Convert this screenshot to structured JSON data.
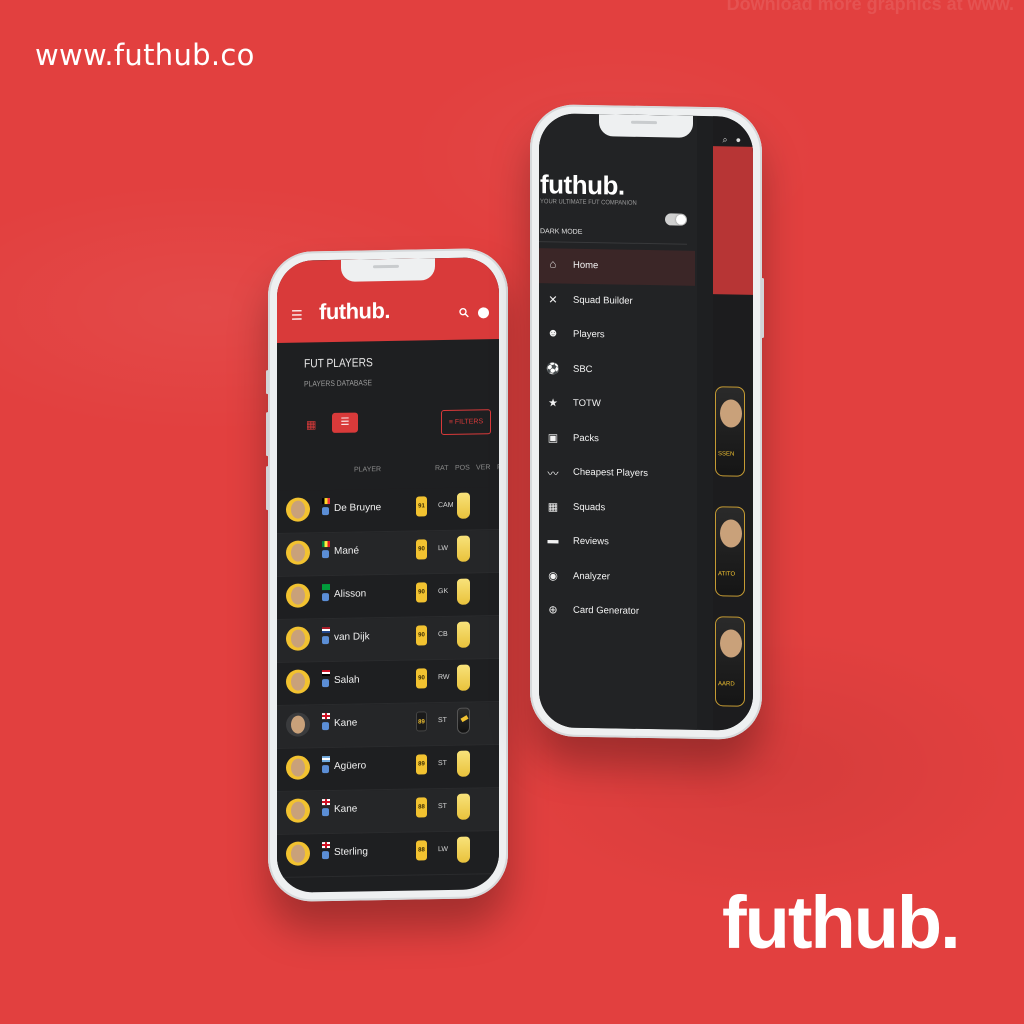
{
  "site_url": "www.futhub.co",
  "watermark": "Download more graphics at www.",
  "brand_logo": "futhub.",
  "colors": {
    "accent": "#d93a3a",
    "background": "#e2403f",
    "dark": "#1e1f21",
    "gold": "#f2c230"
  },
  "left_phone": {
    "header": {
      "logo": "futhub.",
      "menu_icon": "hamburger-icon",
      "search_icon": "search-icon",
      "user_icon": "user-icon"
    },
    "page_title": "FUT PLAYERS",
    "page_subtitle": "PLAYERS DATABASE",
    "filters_label": "FILTERS",
    "table_headers": {
      "player": "PLAYER",
      "rat": "RAT",
      "pos": "POS",
      "ver": "VER",
      "p": "P"
    },
    "players": [
      {
        "name": "De Bruyne",
        "rating": "91",
        "pos": "CAM",
        "flag": "belgium",
        "dark": false
      },
      {
        "name": "Mané",
        "rating": "90",
        "pos": "LW",
        "flag": "senegal",
        "dark": false
      },
      {
        "name": "Alisson",
        "rating": "90",
        "pos": "GK",
        "flag": "brazil",
        "dark": false
      },
      {
        "name": "van Dijk",
        "rating": "90",
        "pos": "CB",
        "flag": "netherlands",
        "dark": false
      },
      {
        "name": "Salah",
        "rating": "90",
        "pos": "RW",
        "flag": "egypt",
        "dark": false
      },
      {
        "name": "Kane",
        "rating": "89",
        "pos": "ST",
        "flag": "england",
        "dark": true
      },
      {
        "name": "Agüero",
        "rating": "89",
        "pos": "ST",
        "flag": "argentina",
        "dark": false
      },
      {
        "name": "Kane",
        "rating": "88",
        "pos": "ST",
        "flag": "england",
        "dark": false
      },
      {
        "name": "Sterling",
        "rating": "88",
        "pos": "LW",
        "flag": "england",
        "dark": false
      }
    ]
  },
  "right_phone": {
    "drawer": {
      "logo": "futhub.",
      "tagline": "YOUR ULTIMATE FUT COMPANION",
      "dark_mode_label": "DARK MODE",
      "dark_mode_on": true,
      "items": [
        {
          "label": "Home",
          "icon": "home-icon",
          "glyph": "⌂",
          "active": true
        },
        {
          "label": "Squad Builder",
          "icon": "tools-icon",
          "glyph": "✕",
          "active": false
        },
        {
          "label": "Players",
          "icon": "users-icon",
          "glyph": "☻",
          "active": false
        },
        {
          "label": "SBC",
          "icon": "football-icon",
          "glyph": "⚽",
          "active": false
        },
        {
          "label": "TOTW",
          "icon": "star-icon",
          "glyph": "★",
          "active": false
        },
        {
          "label": "Packs",
          "icon": "gift-icon",
          "glyph": "▣",
          "active": false
        },
        {
          "label": "Cheapest Players",
          "icon": "trend-icon",
          "glyph": "〰",
          "active": false
        },
        {
          "label": "Squads",
          "icon": "grid-icon",
          "glyph": "▦",
          "active": false
        },
        {
          "label": "Reviews",
          "icon": "comment-icon",
          "glyph": "▬",
          "active": false
        },
        {
          "label": "Analyzer",
          "icon": "magnifier-icon",
          "glyph": "◉",
          "active": false
        },
        {
          "label": "Card Generator",
          "icon": "download-icon",
          "glyph": "⊕",
          "active": false
        }
      ]
    },
    "background_cards": [
      "SSEN",
      "ATITO",
      "AARD"
    ]
  }
}
